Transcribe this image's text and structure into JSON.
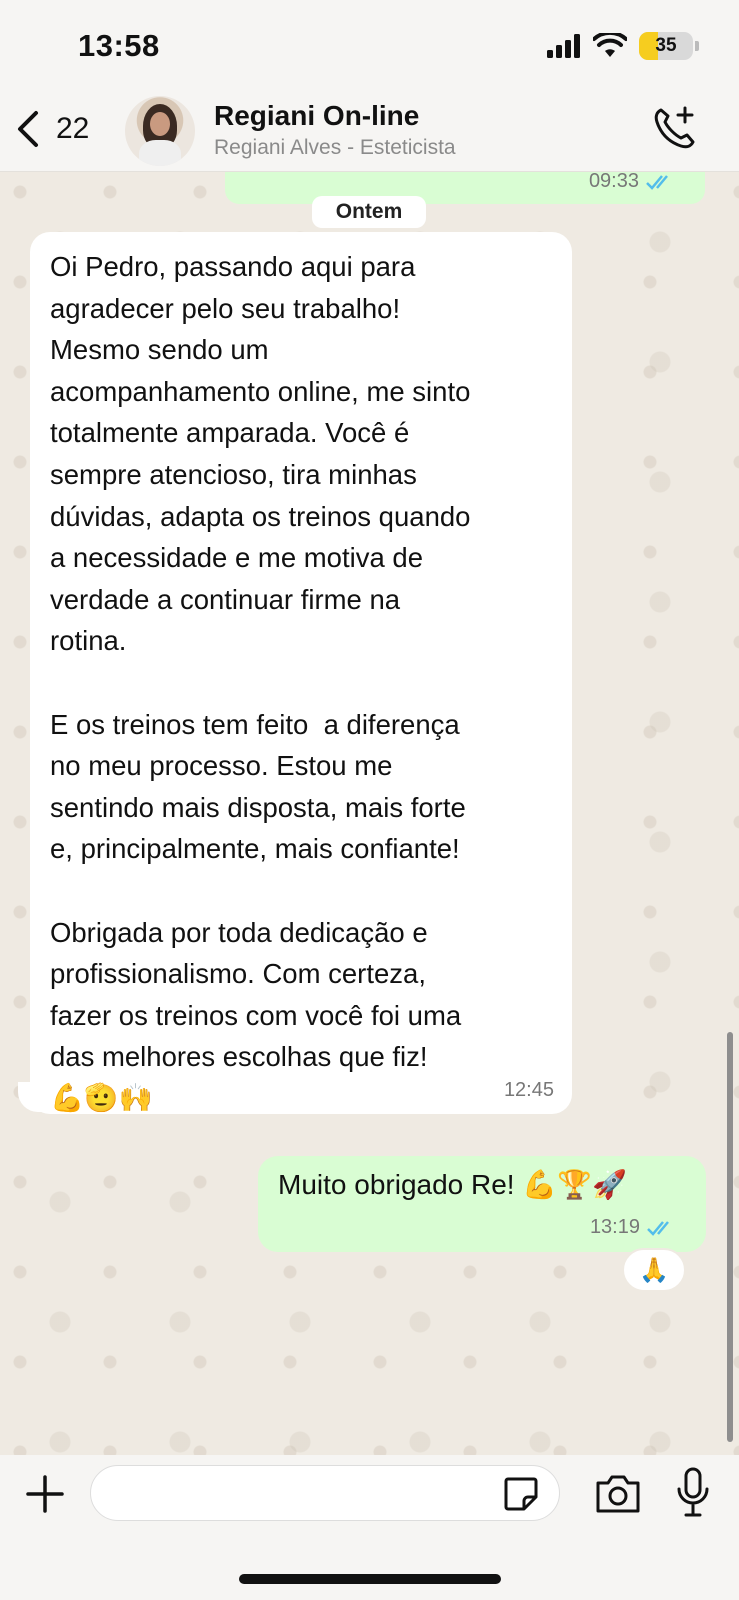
{
  "status_bar": {
    "time": "13:58",
    "battery": "35",
    "battery_level": 0.35,
    "battery_color": "#f6cd1f"
  },
  "header": {
    "back_count": "22",
    "contact_name": "Regiani On-line",
    "contact_subtitle": "Regiani Alves - Esteticista",
    "back_icon": "chevron-left-icon",
    "call_icon": "phone-add-icon"
  },
  "chat": {
    "previous_message_time": "09:33",
    "day_separator": "Ontem",
    "incoming_message": {
      "text": "Oi Pedro, passando aqui para\nagradecer pelo seu trabalho!\nMesmo sendo um\nacompanhamento online, me sinto\ntotalmente amparada. Você é\nsempre atencioso, tira minhas\ndúvidas, adapta os treinos quando\na necessidade e me motiva de\nverdade a continuar firme na\nrotina.\n\nE os treinos tem feito  a diferença\nno meu processo. Estou me\nsentindo mais disposta, mais forte\ne, principalmente, mais confiante!\n\nObrigada por toda dedicação e\nprofissionalismo. Com certeza,\nfazer os treinos com você foi uma\ndas melhores escolhas que fiz!",
      "emojis": "💪🫡🙌",
      "time": "12:45"
    },
    "outgoing_message": {
      "text": "Muito obrigado Re!",
      "emojis": "💪🏆🚀",
      "time": "13:19"
    },
    "reaction": "🙏",
    "colors": {
      "outgoing_bubble": "#d9fdd3",
      "incoming_bubble": "#ffffff",
      "read_ticks": "#53bdeb"
    }
  },
  "composer": {
    "input_value": "",
    "icons": [
      "plus-icon",
      "sticker-icon",
      "camera-icon",
      "microphone-icon"
    ]
  }
}
